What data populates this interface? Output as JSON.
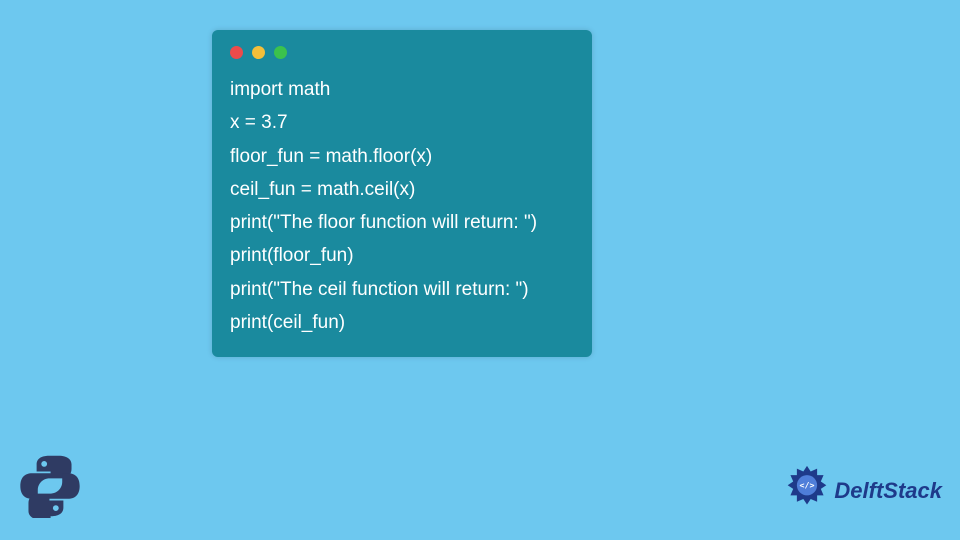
{
  "code": {
    "lines": [
      "import math",
      "x = 3.7",
      "floor_fun = math.floor(x)",
      "ceil_fun = math.ceil(x)",
      "print(\"The floor function will return: \")",
      "print(floor_fun)",
      "print(\"The ceil function will return: \")",
      "print(ceil_fun)"
    ]
  },
  "branding": {
    "delftstack": "DelftStack"
  },
  "colors": {
    "page_bg": "#6dc8ef",
    "window_bg": "#1a8a9e",
    "code_text": "#ffffff",
    "dot_red": "#ec4b4b",
    "dot_yellow": "#f4bf3a",
    "dot_green": "#3bc24d",
    "brand_text": "#1e3a8a"
  }
}
